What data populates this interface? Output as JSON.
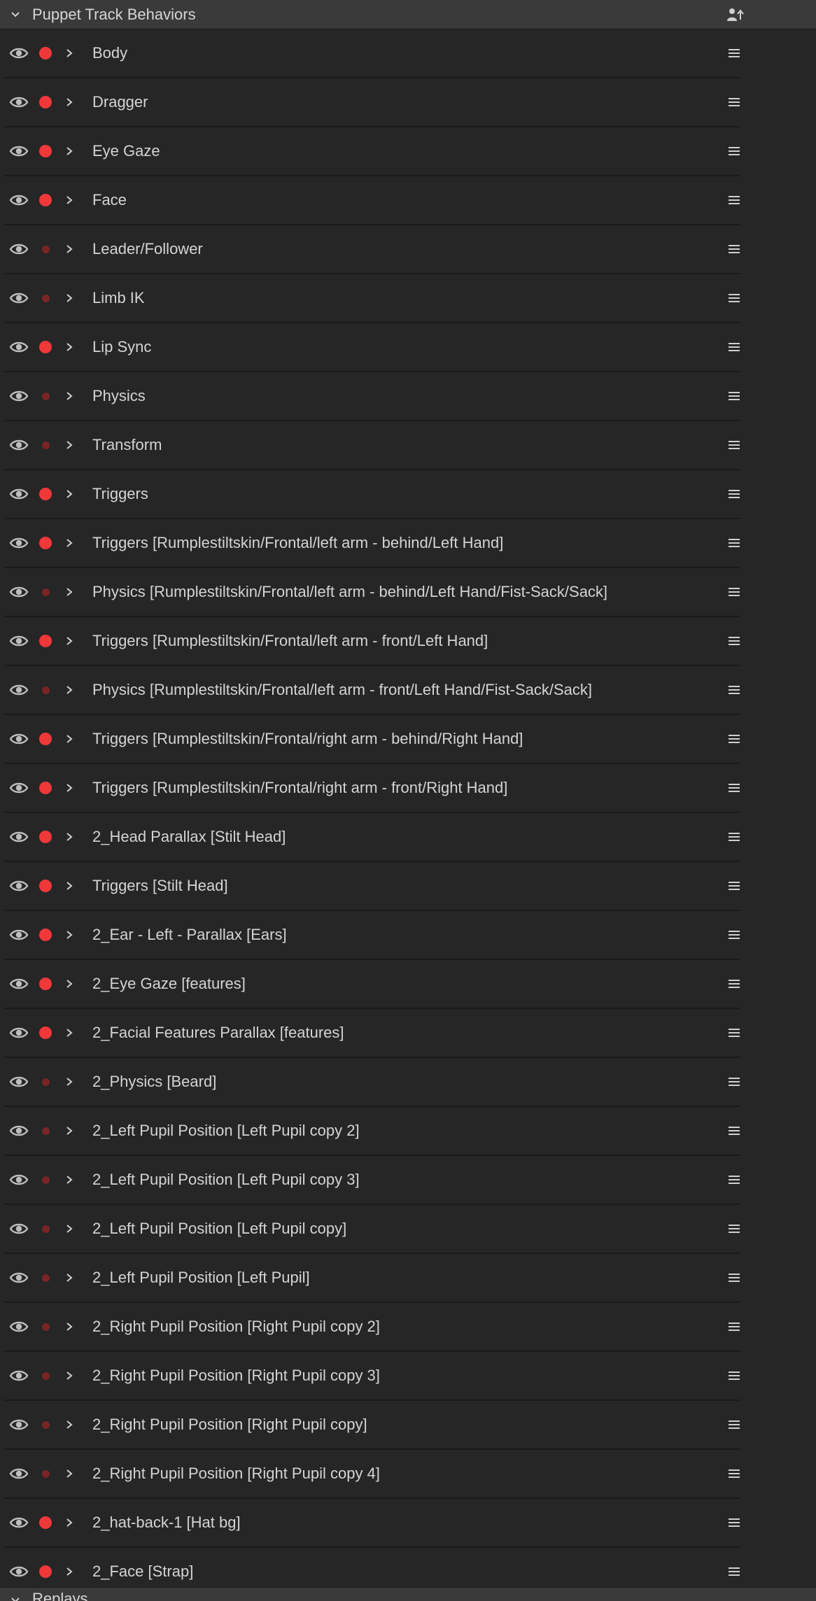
{
  "panel": {
    "title": "Puppet Track Behaviors",
    "collapse_icon": "chevron-down-icon",
    "header_action_icon": "puppet-upload-icon"
  },
  "colors": {
    "record_on": "#f0383b",
    "record_off": "#7a2426",
    "background": "#262626",
    "header": "#3a3a3a",
    "text": "#d4d4d4"
  },
  "behaviors": [
    {
      "label": "Body",
      "armed": true
    },
    {
      "label": "Dragger",
      "armed": true
    },
    {
      "label": "Eye Gaze",
      "armed": true
    },
    {
      "label": "Face",
      "armed": true
    },
    {
      "label": "Leader/Follower",
      "armed": false
    },
    {
      "label": "Limb IK",
      "armed": false
    },
    {
      "label": "Lip Sync",
      "armed": true
    },
    {
      "label": "Physics",
      "armed": false
    },
    {
      "label": "Transform",
      "armed": false
    },
    {
      "label": "Triggers",
      "armed": true
    },
    {
      "label": "Triggers [Rumplestiltskin/Frontal/left arm - behind/Left Hand]",
      "armed": true
    },
    {
      "label": "Physics [Rumplestiltskin/Frontal/left arm - behind/Left Hand/Fist-Sack/Sack]",
      "armed": false
    },
    {
      "label": "Triggers [Rumplestiltskin/Frontal/left arm - front/Left Hand]",
      "armed": true
    },
    {
      "label": "Physics [Rumplestiltskin/Frontal/left arm - front/Left Hand/Fist-Sack/Sack]",
      "armed": false
    },
    {
      "label": "Triggers [Rumplestiltskin/Frontal/right arm - behind/Right Hand]",
      "armed": true
    },
    {
      "label": "Triggers [Rumplestiltskin/Frontal/right arm - front/Right Hand]",
      "armed": true
    },
    {
      "label": "2_Head Parallax [Stilt Head]",
      "armed": true
    },
    {
      "label": "Triggers [Stilt Head]",
      "armed": true
    },
    {
      "label": "2_Ear - Left - Parallax [Ears]",
      "armed": true
    },
    {
      "label": "2_Eye Gaze [features]",
      "armed": true
    },
    {
      "label": "2_Facial Features Parallax [features]",
      "armed": true
    },
    {
      "label": "2_Physics [Beard]",
      "armed": false
    },
    {
      "label": "2_Left Pupil Position [Left Pupil copy 2]",
      "armed": false
    },
    {
      "label": "2_Left Pupil Position [Left Pupil copy 3]",
      "armed": false
    },
    {
      "label": "2_Left Pupil Position [Left Pupil copy]",
      "armed": false
    },
    {
      "label": "2_Left Pupil Position [Left Pupil]",
      "armed": false
    },
    {
      "label": "2_Right Pupil Position [Right Pupil copy 2]",
      "armed": false
    },
    {
      "label": "2_Right Pupil Position [Right Pupil copy 3]",
      "armed": false
    },
    {
      "label": "2_Right Pupil Position [Right Pupil copy]",
      "armed": false
    },
    {
      "label": "2_Right Pupil Position [Right Pupil copy 4]",
      "armed": false
    },
    {
      "label": "2_hat-back-1 [Hat bg]",
      "armed": true
    },
    {
      "label": "2_Face [Strap]",
      "armed": true
    }
  ],
  "next_section": {
    "title": "Replays"
  }
}
